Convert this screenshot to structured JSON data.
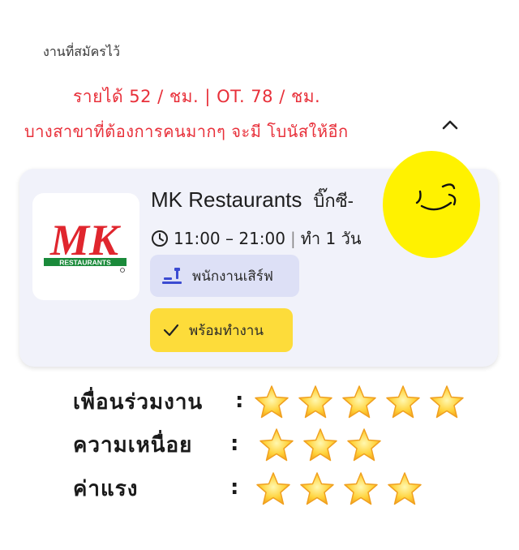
{
  "section_title": "งานที่สมัครไว้",
  "promo": {
    "line1": "รายได้ 52 / ชม. | OT. 78 / ชม.",
    "line2": "บางสาขาที่ต้องการคนมากๆ จะมี โบนัสให้อีก"
  },
  "collapse_icon": "chevron-up-icon",
  "job": {
    "logo_text": "MK",
    "logo_subtext": "RESTAURANTS",
    "title": "MK Restaurants",
    "branch": "บิ๊กซี-",
    "time": "11:00 – 21:00",
    "separator": "|",
    "duration": "ทำ 1 วัน",
    "role": "พนักงานเสิร์ฟ",
    "ready_label": "พร้อมทำงาน"
  },
  "ratings": [
    {
      "label": "เพื่อนร่วมงาน",
      "colon": ":",
      "stars": 5
    },
    {
      "label": "ความเหนื่อย",
      "colon": ":",
      "stars": 3
    },
    {
      "label": "ค่าแรง",
      "colon": ":",
      "stars": 4
    }
  ],
  "colors": {
    "promo_text": "#e8303a",
    "card_bg": "#f1f2fa",
    "role_chip": "#dde0f6",
    "ready_chip": "#fddc3a",
    "logo_red": "#e0262e",
    "logo_green": "#1a8a3a",
    "emoji_yellow": "#fff200"
  }
}
